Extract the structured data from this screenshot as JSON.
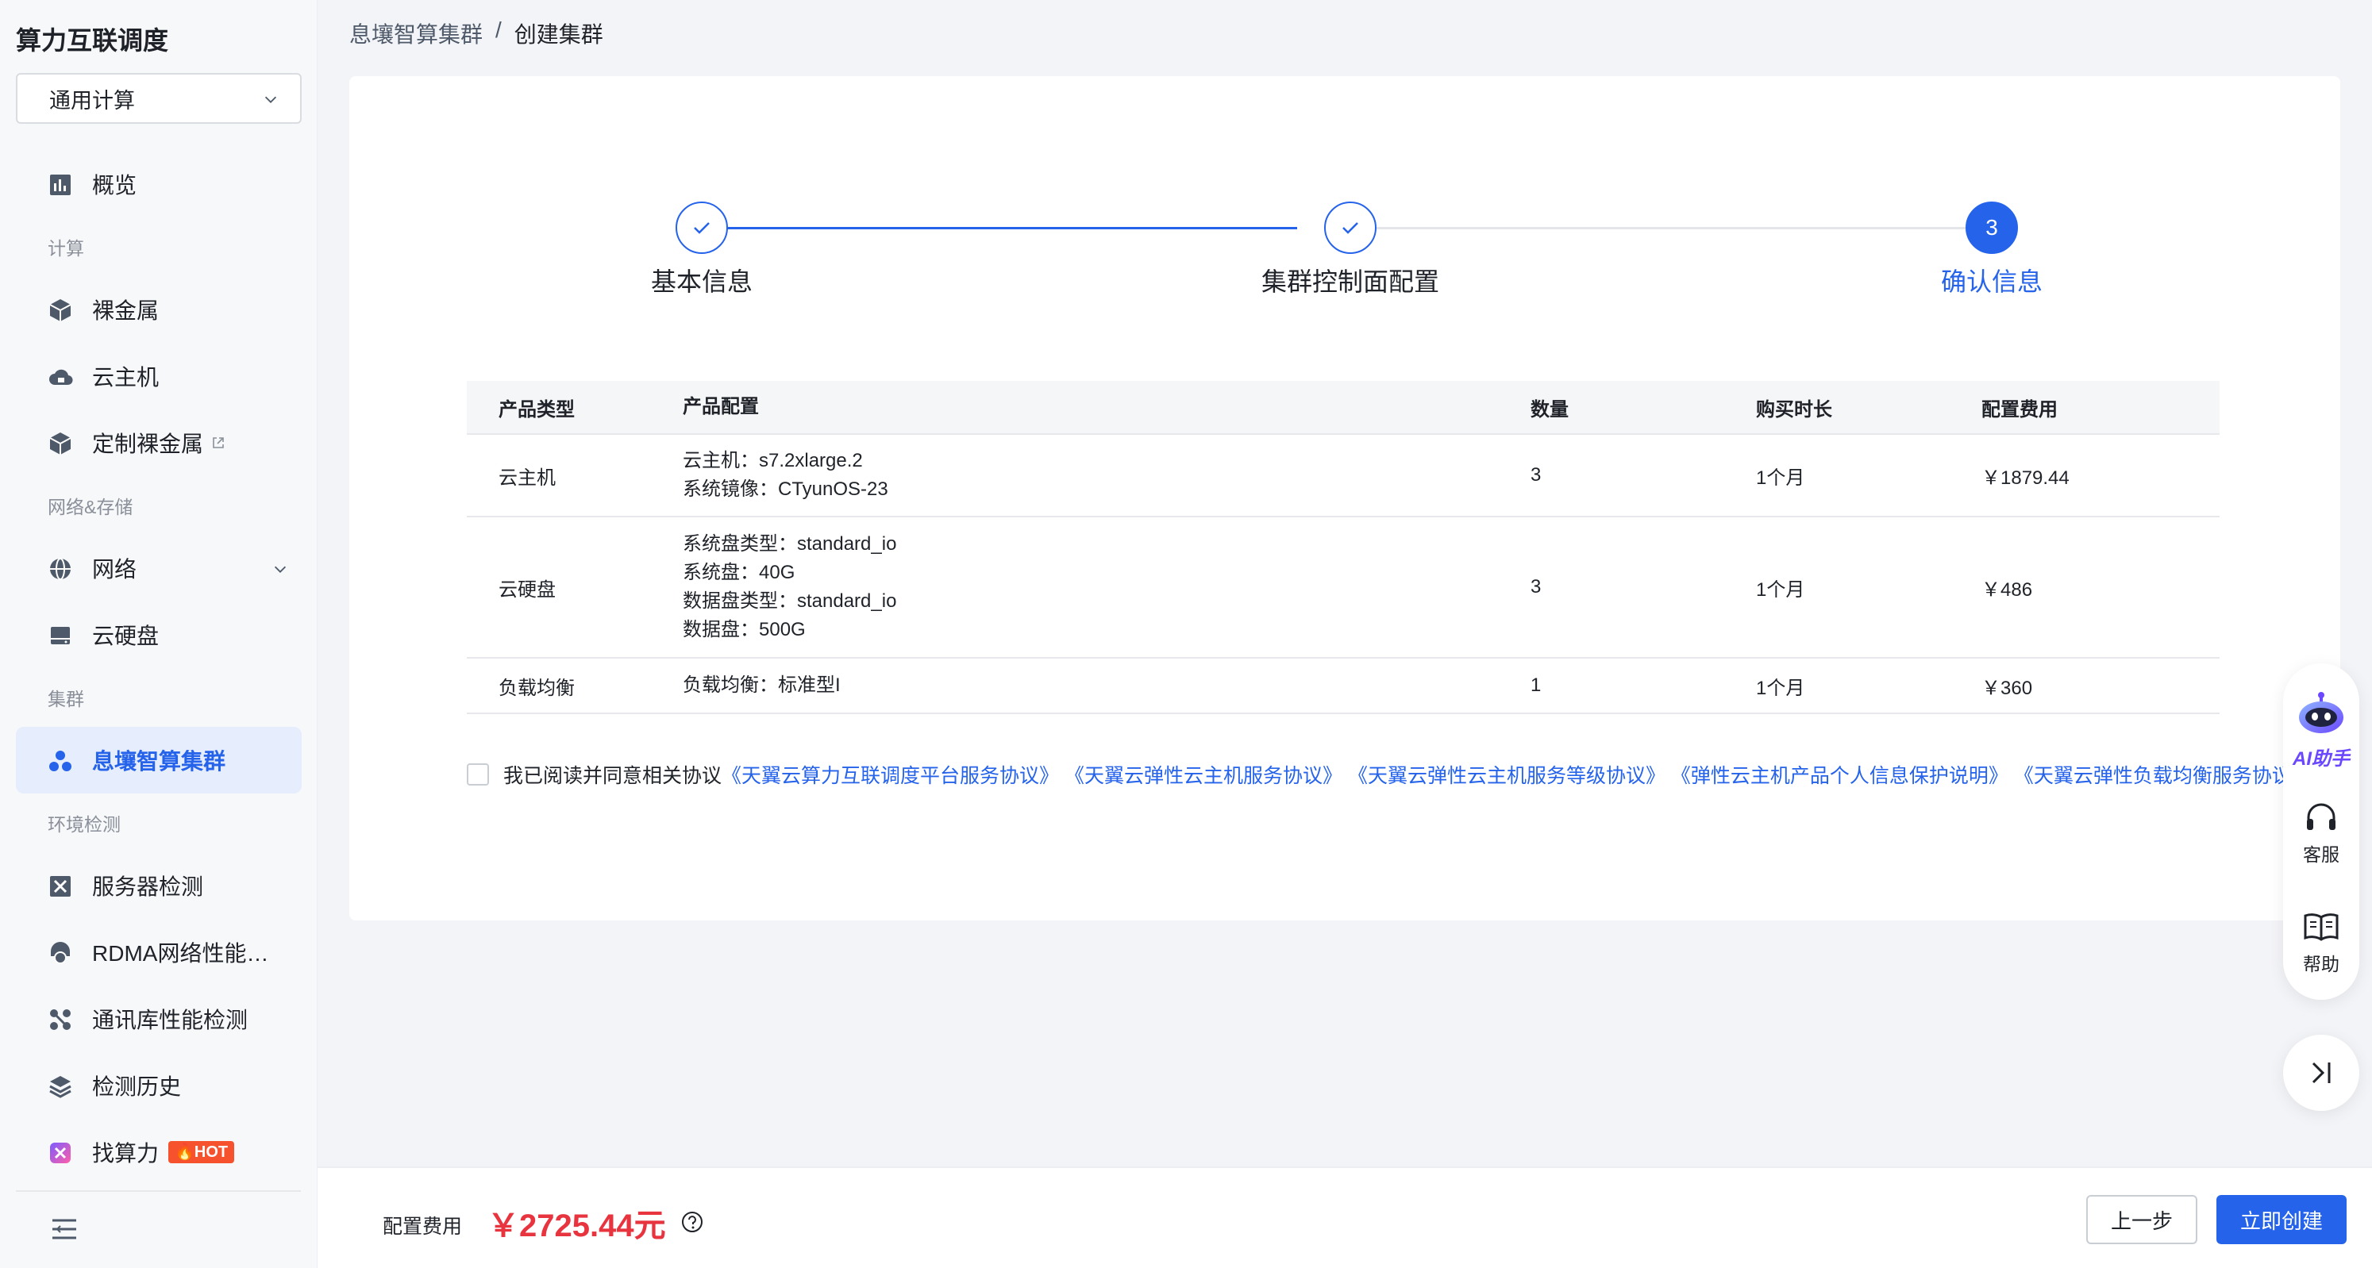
{
  "sidebar": {
    "app_title": "算力互联调度",
    "select_value": "通用计算",
    "items": {
      "overview": "概览",
      "group_compute": "计算",
      "bare_metal": "裸金属",
      "cloud_host": "云主机",
      "custom_bare_metal": "定制裸金属",
      "group_network_storage": "网络&存储",
      "network": "网络",
      "cloud_disk": "云硬盘",
      "group_cluster": "集群",
      "xirang_cluster": "息壤智算集群",
      "group_env": "环境检测",
      "server_check": "服务器检测",
      "rdma_check": "RDMA网络性能…",
      "comm_lib_check": "通讯库性能检测",
      "check_history": "检测历史",
      "find_compute": "找算力",
      "hot_badge": "🔥HOT"
    }
  },
  "breadcrumb": {
    "parent": "息壤智算集群",
    "separator": "/",
    "current": "创建集群"
  },
  "steps": [
    {
      "label": "基本信息",
      "state": "done"
    },
    {
      "label": "集群控制面配置",
      "state": "done"
    },
    {
      "label": "确认信息",
      "state": "current",
      "number": "3"
    }
  ],
  "table": {
    "headers": [
      "产品类型",
      "产品配置",
      "数量",
      "购买时长",
      "配置费用"
    ],
    "rows": [
      {
        "type": "云主机",
        "config": [
          "云主机：s7.2xlarge.2",
          "系统镜像：CTyunOS-23"
        ],
        "qty": "3",
        "duration": "1个月",
        "fee": "￥1879.44"
      },
      {
        "type": "云硬盘",
        "config": [
          "系统盘类型：standard_io",
          "系统盘：40G",
          "数据盘类型：standard_io",
          "数据盘：500G"
        ],
        "qty": "3",
        "duration": "1个月",
        "fee": "￥486"
      },
      {
        "type": "负载均衡",
        "config": [
          "负载均衡：标准型I"
        ],
        "qty": "1",
        "duration": "1个月",
        "fee": "￥360"
      }
    ]
  },
  "agreement": {
    "prefix": "我已阅读并同意相关协议",
    "links": [
      "《天翼云算力互联调度平台服务协议》",
      "《天翼云弹性云主机服务协议》",
      "《天翼云弹性云主机服务等级协议》",
      "《弹性云主机产品个人信息保护说明》",
      "《天翼云弹性负载均衡服务协议》"
    ]
  },
  "float_tools": {
    "ai": "AI助手",
    "service": "客服",
    "help": "帮助"
  },
  "footer": {
    "fee_label": "配置费用",
    "fee_value": "￥2725.44元",
    "prev": "上一步",
    "create": "立即创建"
  },
  "colors": {
    "primary": "#2563eb",
    "price": "#e8343f",
    "hot": "#f5522d"
  }
}
